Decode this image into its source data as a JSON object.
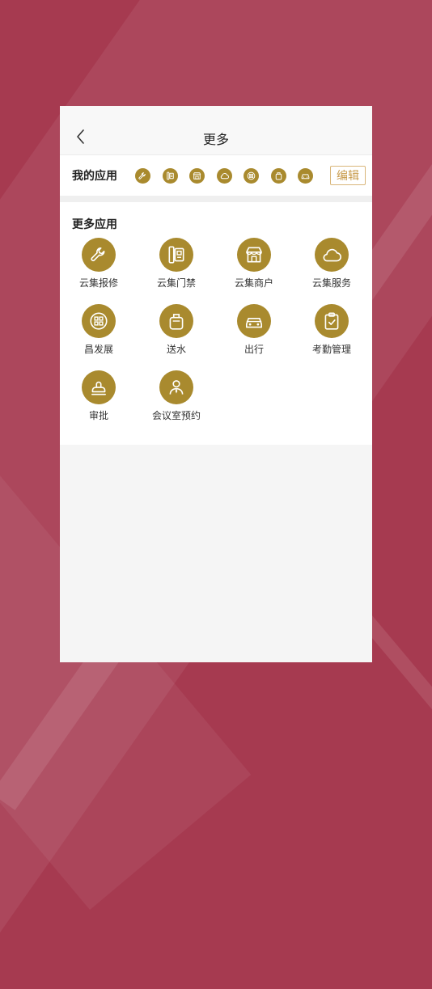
{
  "header": {
    "title": "更多",
    "back_icon": "chevron-left-icon"
  },
  "my_apps": {
    "label": "我的应用",
    "edit_label": "编辑",
    "icons": [
      "wrench-icon",
      "door-icon",
      "store-icon",
      "cloud-icon",
      "grid-badge-icon",
      "water-bottle-icon",
      "car-icon"
    ]
  },
  "more_apps": {
    "title": "更多应用",
    "items": [
      {
        "label": "云集报修",
        "icon": "wrench-icon"
      },
      {
        "label": "云集门禁",
        "icon": "door-icon"
      },
      {
        "label": "云集商户",
        "icon": "store-icon"
      },
      {
        "label": "云集服务",
        "icon": "cloud-icon"
      },
      {
        "label": "昌发展",
        "icon": "grid-badge-icon"
      },
      {
        "label": "送水",
        "icon": "water-bottle-icon"
      },
      {
        "label": "出行",
        "icon": "car-icon"
      },
      {
        "label": "考勤管理",
        "icon": "clipboard-check-icon"
      },
      {
        "label": "审批",
        "icon": "stamp-icon"
      },
      {
        "label": "会议室预约",
        "icon": "person-icon"
      }
    ]
  },
  "colors": {
    "background": "#a63a50",
    "icon_gold": "#a98a2e",
    "edit_border": "#d9b67a",
    "edit_text": "#c79a4a"
  }
}
